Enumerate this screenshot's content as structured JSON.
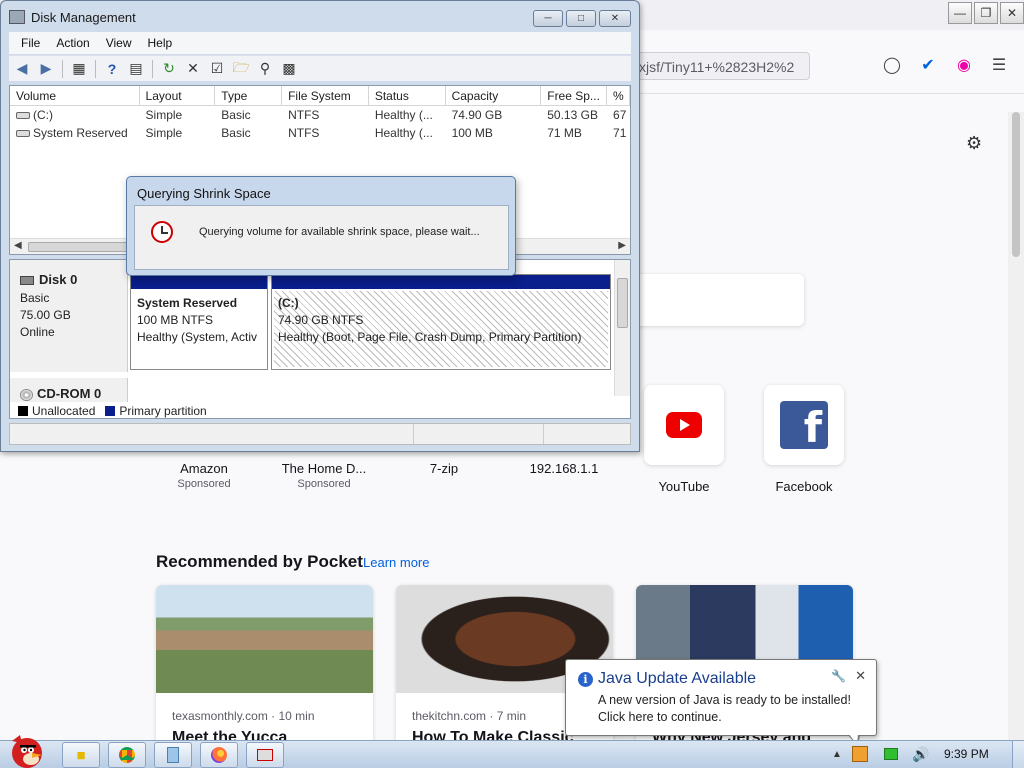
{
  "firefox": {
    "url_text": "xjsf/Tiny11+%2823H2%2",
    "top_sites": [
      {
        "label": "Amazon",
        "sponsored": "Sponsored"
      },
      {
        "label": "The Home D...",
        "sponsored": "Sponsored"
      },
      {
        "label": "7-zip",
        "sponsored": ""
      },
      {
        "label": "192.168.1.1",
        "sponsored": ""
      },
      {
        "label": "YouTube",
        "sponsored": ""
      },
      {
        "label": "Facebook",
        "sponsored": ""
      }
    ],
    "pocket": {
      "heading": "Recommended by Pocket",
      "learn_more": "Learn more",
      "cards": [
        {
          "source": "texasmonthly.com · 10 min",
          "title": "Meet the Yucca"
        },
        {
          "source": "thekitchn.com · 7 min",
          "title": "How To Make Classic"
        },
        {
          "source": "",
          "title": "Why New Jersey and"
        }
      ]
    }
  },
  "disk_mgmt": {
    "title": "Disk Management",
    "menu": [
      "File",
      "Action",
      "View",
      "Help"
    ],
    "columns": [
      "Volume",
      "Layout",
      "Type",
      "File System",
      "Status",
      "Capacity",
      "Free Sp...",
      "%"
    ],
    "rows": [
      [
        "(C:)",
        "Simple",
        "Basic",
        "NTFS",
        "Healthy (...",
        "74.90 GB",
        "50.13 GB",
        "67"
      ],
      [
        "System Reserved",
        "Simple",
        "Basic",
        "NTFS",
        "Healthy (...",
        "100 MB",
        "71 MB",
        "71"
      ]
    ],
    "disk0": {
      "name": "Disk 0",
      "type": "Basic",
      "size": "75.00 GB",
      "state": "Online"
    },
    "partitions": [
      {
        "name": "System Reserved",
        "size": "100 MB NTFS",
        "status": "Healthy (System, Activ"
      },
      {
        "name": "(C:)",
        "size": "74.90 GB NTFS",
        "status": "Healthy (Boot, Page File, Crash Dump, Primary Partition)"
      }
    ],
    "cdrom": "CD-ROM 0",
    "legend": [
      {
        "label": "Unallocated",
        "color": "#000000"
      },
      {
        "label": "Primary partition",
        "color": "#0a1e8c"
      }
    ]
  },
  "dialog": {
    "title": "Querying Shrink Space",
    "message": "Querying volume for available shrink space, please wait..."
  },
  "java_popup": {
    "title": "Java Update Available",
    "line1": "A new version of Java is ready to be installed!",
    "line2": "Click here to continue."
  },
  "taskbar": {
    "time": "9:39 PM"
  }
}
